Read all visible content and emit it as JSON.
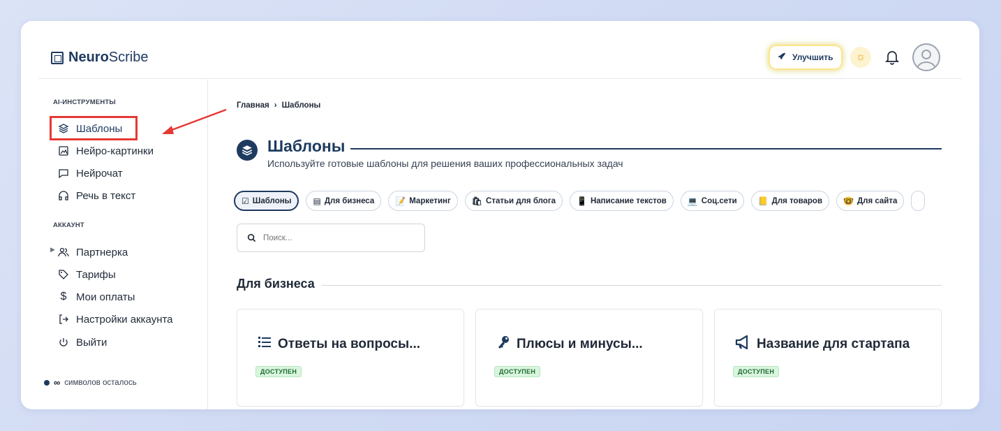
{
  "app": {
    "logo_bold": "Neuro",
    "logo_rest": "Scribe"
  },
  "header": {
    "upgrade_label": "Улучшить",
    "theme_icon": "sun-icon",
    "notifications_icon": "bell-icon",
    "avatar_icon": "user-avatar-icon"
  },
  "sidebar": {
    "section_tools": "AI-ИНСТРУМЕНТЫ",
    "tools": [
      {
        "label": "Шаблоны",
        "icon": "layers-icon"
      },
      {
        "label": "Нейро-картинки",
        "icon": "image-icon"
      },
      {
        "label": "Нейрочат",
        "icon": "chat-icon"
      },
      {
        "label": "Речь в текст",
        "icon": "headphones-icon"
      }
    ],
    "section_account": "АККАУНТ",
    "account": [
      {
        "label": "Партнерка",
        "icon": "users-icon"
      },
      {
        "label": "Тарифы",
        "icon": "tag-icon"
      },
      {
        "label": "Мои оплаты",
        "icon": "dollar-icon"
      },
      {
        "label": "Настройки аккаунта",
        "icon": "login-icon"
      },
      {
        "label": "Выйти",
        "icon": "power-icon"
      }
    ],
    "credits_symbol": "∞",
    "credits_text": "символов осталось"
  },
  "main": {
    "breadcrumb": [
      "Главная",
      "›",
      "Шаблоны"
    ],
    "title": "Шаблоны",
    "subtitle": "Используйте готовые шаблоны для решения ваших профессиональных задач",
    "chips": [
      {
        "label": "Шаблоны",
        "icon": "☑",
        "active": true
      },
      {
        "label": "Для бизнеса",
        "icon": "▤"
      },
      {
        "label": "Маркетинг",
        "icon": "📝"
      },
      {
        "label": "Статьи для блога",
        "icon": "🛍"
      },
      {
        "label": "Написание текстов",
        "icon": "📱"
      },
      {
        "label": "Соц.сети",
        "icon": "💻"
      },
      {
        "label": "Для товаров",
        "icon": "📒"
      },
      {
        "label": "Для сайта",
        "icon": "🤓"
      }
    ],
    "search_placeholder": "Поиск...",
    "section_title": "Для бизнеса",
    "cards": [
      {
        "title": "Ответы на вопросы...",
        "icon": "list-icon",
        "badge": "ДОСТУПЕН"
      },
      {
        "title": "Плюсы и минусы...",
        "icon": "key-icon",
        "badge": "ДОСТУПЕН"
      },
      {
        "title": "Название для стартапа",
        "icon": "megaphone-icon",
        "badge": "ДОСТУПЕН"
      }
    ]
  },
  "colors": {
    "brand": "#1e3a5f",
    "annotation": "#e53935",
    "badge_bg": "#d9f5dd"
  }
}
